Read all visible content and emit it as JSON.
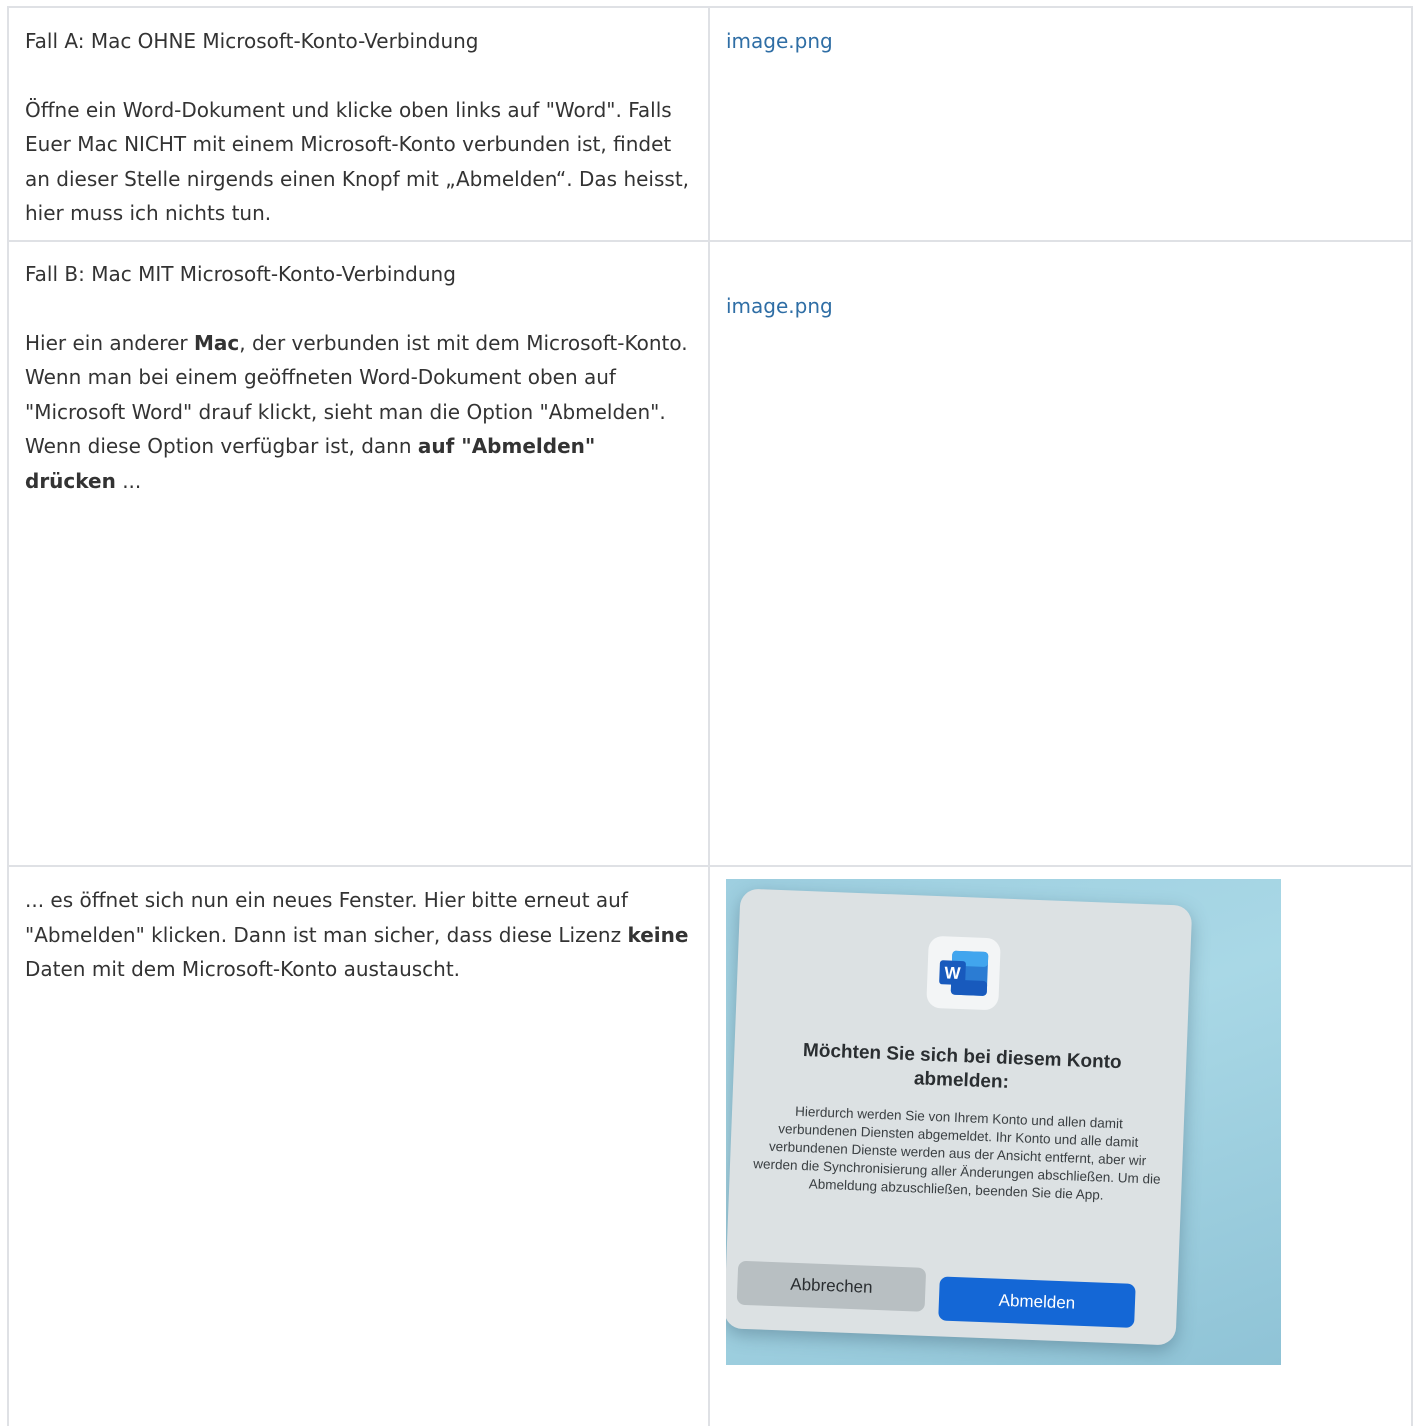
{
  "rows": [
    {
      "left": {
        "heading": "Fall A: Mac OHNE Microsoft-Konto-Verbindung",
        "text": "Öffne ein Word-Dokument und klicke oben links auf \"Word\". Falls Euer Mac NICHT mit einem Microsoft-Konto verbunden ist, findet an dieser Stelle nirgends einen Knopf mit „Abmelden“. Das heisst, hier muss ich nichts tun."
      },
      "right": {
        "link": "image.png"
      }
    },
    {
      "left": {
        "heading": "Fall B: Mac MIT Microsoft-Konto-Verbindung",
        "text_1": "Hier ein anderer ",
        "bold_1": "Mac",
        "text_2": ", der verbunden ist mit dem Microsoft-Konto. Wenn man bei einem geöffneten Word-Dokument oben auf \"Microsoft Word\" drauf klickt, sieht man die Option \"Abmelden\". Wenn diese Option verfügbar ist, dann ",
        "bold_2": "auf \"Abmelden\" drücken",
        "text_3": " ..."
      },
      "right": {
        "link": "image.png"
      }
    },
    {
      "left": {
        "text_1": "... es öffnet sich nun ein neues Fenster. Hier bitte erneut auf \"Abmelden\" klicken. Dann ist man sicher, dass diese Lizenz ",
        "bold_1": "keine",
        "text_2": " Daten mit dem Microsoft-Konto austauscht."
      },
      "right": {
        "screenshot": {
          "icon": "word-app-icon",
          "title": "Möchten Sie sich bei diesem Konto abmelden:",
          "body": "Hierdurch werden Sie von Ihrem Konto und allen damit verbundenen Diensten abgemeldet. Ihr Konto und alle damit verbundenen Dienste werden aus der Ansicht entfernt, aber wir werden die Synchronisierung aller Änderungen abschließen. Um die Abmeldung abzuschließen, beenden Sie die App.",
          "cancel_label": "Abbrechen",
          "signout_label": "Abmelden",
          "colors": {
            "background": "#9ecfe0",
            "dialog": "#dce1e3",
            "primary_button": "#1467d6",
            "word_blue": "#185abd"
          }
        }
      }
    }
  ]
}
